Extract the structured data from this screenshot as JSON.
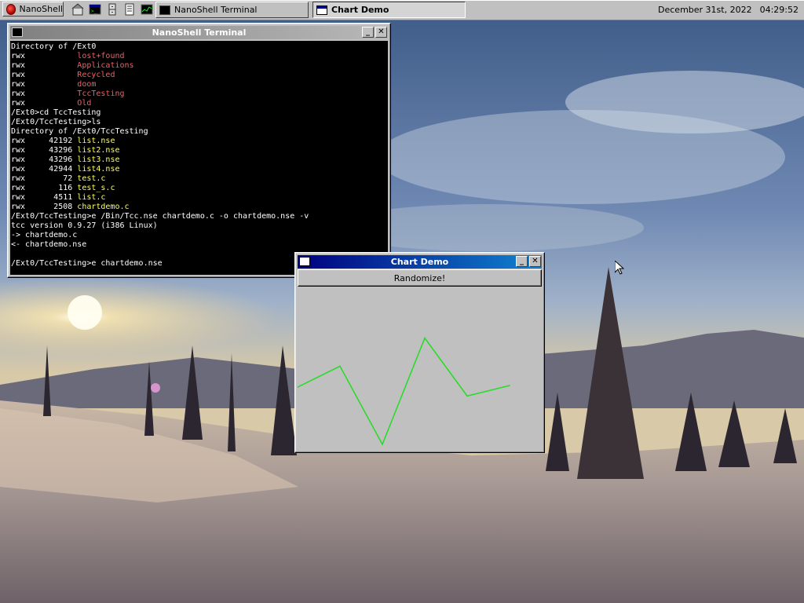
{
  "taskbar": {
    "start_label": "NanoShell",
    "tasks": [
      {
        "label": "NanoShell Terminal",
        "active": false
      },
      {
        "label": "Chart Demo",
        "active": true
      }
    ],
    "date": "December 31st, 2022",
    "time": "04:29:52"
  },
  "terminal": {
    "title": "NanoShell Terminal",
    "lines": [
      {
        "segments": [
          {
            "t": "Directory of /Ext0",
            "c": "plain"
          }
        ]
      },
      {
        "segments": [
          {
            "t": "rwx           ",
            "c": "perm"
          },
          {
            "t": "lost+found",
            "c": "dir"
          }
        ]
      },
      {
        "segments": [
          {
            "t": "rwx           ",
            "c": "perm"
          },
          {
            "t": "Applications",
            "c": "dir"
          }
        ]
      },
      {
        "segments": [
          {
            "t": "rwx           ",
            "c": "perm"
          },
          {
            "t": "Recycled",
            "c": "dir"
          }
        ]
      },
      {
        "segments": [
          {
            "t": "rwx           ",
            "c": "perm"
          },
          {
            "t": "doom",
            "c": "dir"
          }
        ]
      },
      {
        "segments": [
          {
            "t": "rwx           ",
            "c": "perm"
          },
          {
            "t": "TccTesting",
            "c": "dir"
          }
        ]
      },
      {
        "segments": [
          {
            "t": "rwx           ",
            "c": "perm"
          },
          {
            "t": "Old",
            "c": "dir"
          }
        ]
      },
      {
        "segments": [
          {
            "t": "/Ext0>cd TccTesting",
            "c": "plain"
          }
        ]
      },
      {
        "segments": [
          {
            "t": "/Ext0/TccTesting>ls",
            "c": "plain"
          }
        ]
      },
      {
        "segments": [
          {
            "t": "Directory of /Ext0/TccTesting",
            "c": "plain"
          }
        ]
      },
      {
        "segments": [
          {
            "t": "rwx     42192 ",
            "c": "perm"
          },
          {
            "t": "list.nse",
            "c": "file"
          }
        ]
      },
      {
        "segments": [
          {
            "t": "rwx     43296 ",
            "c": "perm"
          },
          {
            "t": "list2.nse",
            "c": "file"
          }
        ]
      },
      {
        "segments": [
          {
            "t": "rwx     43296 ",
            "c": "perm"
          },
          {
            "t": "list3.nse",
            "c": "file"
          }
        ]
      },
      {
        "segments": [
          {
            "t": "rwx     42944 ",
            "c": "perm"
          },
          {
            "t": "list4.nse",
            "c": "file"
          }
        ]
      },
      {
        "segments": [
          {
            "t": "rwx        72 ",
            "c": "perm"
          },
          {
            "t": "test.c",
            "c": "file"
          }
        ]
      },
      {
        "segments": [
          {
            "t": "rwx       116 ",
            "c": "perm"
          },
          {
            "t": "test_s.c",
            "c": "file"
          }
        ]
      },
      {
        "segments": [
          {
            "t": "rwx      4511 ",
            "c": "perm"
          },
          {
            "t": "list.c",
            "c": "file"
          }
        ]
      },
      {
        "segments": [
          {
            "t": "rwx      2508 ",
            "c": "perm"
          },
          {
            "t": "chartdemo.c",
            "c": "file"
          }
        ]
      },
      {
        "segments": [
          {
            "t": "/Ext0/TccTesting>e /Bin/Tcc.nse chartdemo.c -o chartdemo.nse -v",
            "c": "plain"
          }
        ]
      },
      {
        "segments": [
          {
            "t": "tcc version 0.9.27 (i386 Linux)",
            "c": "plain"
          }
        ]
      },
      {
        "segments": [
          {
            "t": "-> chartdemo.c",
            "c": "plain"
          }
        ]
      },
      {
        "segments": [
          {
            "t": "<- chartdemo.nse",
            "c": "plain"
          }
        ]
      },
      {
        "segments": [
          {
            "t": "",
            "c": "plain"
          }
        ]
      },
      {
        "segments": [
          {
            "t": "/Ext0/TccTesting>e chartdemo.nse",
            "c": "plain"
          }
        ]
      }
    ]
  },
  "chart_window": {
    "title": "Chart Demo",
    "button_label": "Randomize!"
  },
  "chart_data": {
    "type": "line",
    "x": [
      0,
      1,
      2,
      3,
      4,
      5
    ],
    "values": [
      77,
      103,
      6,
      138,
      66,
      79
    ],
    "ylim": [
      0,
      200
    ],
    "grid": false,
    "line_color": "#22dd22"
  },
  "colors": {
    "terminal_dir": "#ff5a5a",
    "terminal_file": "#ffff55",
    "active_title": "#000080"
  }
}
